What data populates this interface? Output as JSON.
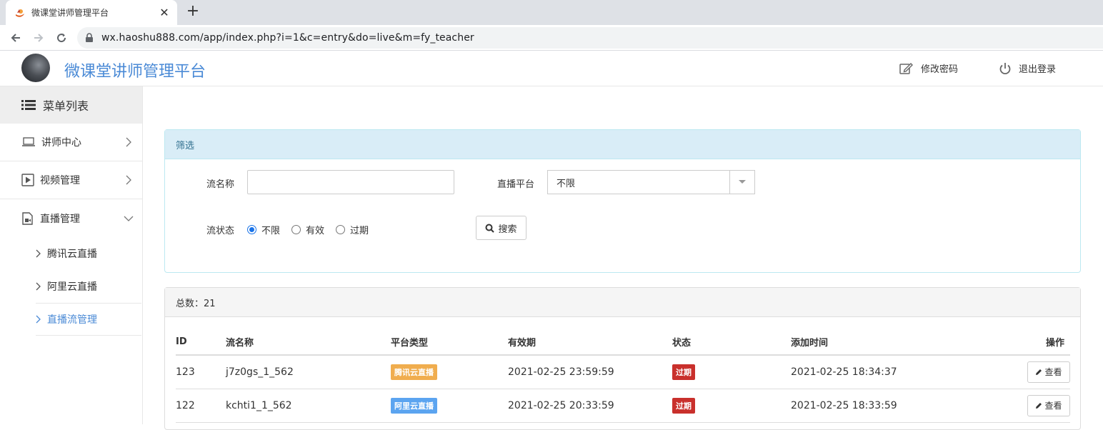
{
  "browser": {
    "tab_title": "微课堂讲师管理平台",
    "new_tab_symbol": "+",
    "close_symbol": "✕",
    "url": "wx.haoshu888.com/app/index.php?i=1&c=entry&do=live&m=fy_teacher"
  },
  "header": {
    "brand": "微课堂讲师管理平台",
    "change_password": "修改密码",
    "logout": "退出登录"
  },
  "sidebar": {
    "title": "菜单列表",
    "items": [
      {
        "label": "讲师中心",
        "icon": "laptop-icon"
      },
      {
        "label": "视频管理",
        "icon": "play-square-icon"
      },
      {
        "label": "直播管理",
        "icon": "live-camera-icon"
      }
    ],
    "sub_items": [
      {
        "label": "腾讯云直播"
      },
      {
        "label": "阿里云直播"
      },
      {
        "label": "直播流管理"
      }
    ]
  },
  "filter": {
    "title": "筛选",
    "stream_name_label": "流名称",
    "stream_name_value": "",
    "platform_label": "直播平台",
    "platform_value": "不限",
    "status_label": "流状态",
    "status_options": [
      "不限",
      "有效",
      "过期"
    ],
    "status_selected": "不限",
    "search_button": "搜索"
  },
  "list": {
    "total_label": "总数：21",
    "columns": [
      "ID",
      "流名称",
      "平台类型",
      "有效期",
      "状态",
      "添加时间",
      "操作"
    ],
    "rows": [
      {
        "id": "123",
        "name": "j7z0gs_1_562",
        "platform": "腾讯云直播",
        "expire": "2021-02-25 23:59:59",
        "status": "过期",
        "added": "2021-02-25 18:34:37",
        "action": "查看"
      },
      {
        "id": "122",
        "name": "kchti1_1_562",
        "platform": "阿里云直播",
        "expire": "2021-02-25 20:33:59",
        "status": "过期",
        "added": "2021-02-25 18:33:59",
        "action": "查看"
      }
    ]
  },
  "colors": {
    "brand_blue": "#4a8ad6",
    "tag_tencent": "#f0ad4e",
    "tag_aliyun": "#5bc0de",
    "tag_expired": "#d9534f"
  }
}
